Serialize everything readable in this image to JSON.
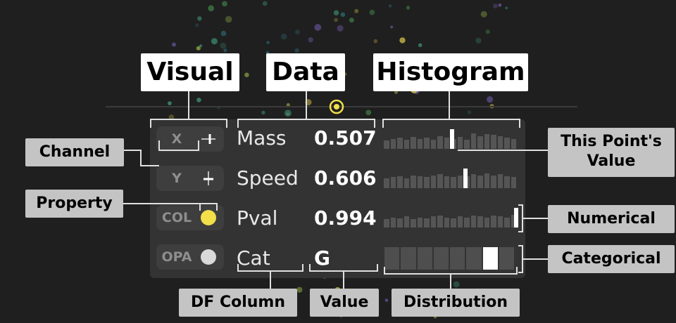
{
  "headers": {
    "visual": "Visual",
    "data": "Data",
    "histogram": "Histogram"
  },
  "callouts": {
    "channel": "Channel",
    "property": "Property",
    "this_point_line1": "This Point's",
    "this_point_line2": "Value",
    "numerical": "Numerical",
    "categorical": "Categorical",
    "df_column": "DF Column",
    "value": "Value",
    "distribution": "Distribution"
  },
  "rows": [
    {
      "channel": "X",
      "icon": "x-position-icon",
      "property": "Mass",
      "value": "0.507",
      "hist": [
        0.45,
        0.55,
        0.6,
        0.5,
        0.65,
        0.55,
        0.6,
        0.5,
        0.7,
        0.6,
        0.55,
        0.65,
        0.5,
        0.85,
        0.7,
        0.8,
        0.75,
        0.7,
        0.6,
        0.55
      ],
      "marker": 0.507
    },
    {
      "channel": "Y",
      "icon": "y-position-icon",
      "property": "Speed",
      "value": "0.606",
      "hist": [
        0.55,
        0.6,
        0.65,
        0.55,
        0.7,
        0.65,
        0.6,
        0.7,
        0.75,
        0.65,
        0.6,
        0.7,
        0.65,
        0.75,
        0.7,
        0.8,
        0.7,
        0.75,
        0.65,
        0.6
      ],
      "marker": 0.606
    },
    {
      "channel": "COL",
      "icon": "color-swatch-icon",
      "swatch": "#f2df4a",
      "property": "Pval",
      "value": "0.994",
      "hist": [
        0.45,
        0.55,
        0.5,
        0.6,
        0.45,
        0.55,
        0.5,
        0.6,
        0.65,
        0.55,
        0.5,
        0.6,
        0.55,
        0.65,
        0.6,
        0.55,
        0.65,
        0.6,
        0.55,
        0.7
      ],
      "marker": 0.994
    },
    {
      "channel": "OPA",
      "icon": "opacity-swatch-icon",
      "swatch": "#d9d9d9",
      "property": "Cat",
      "value": "G",
      "categories": 8,
      "selected": 6
    }
  ]
}
